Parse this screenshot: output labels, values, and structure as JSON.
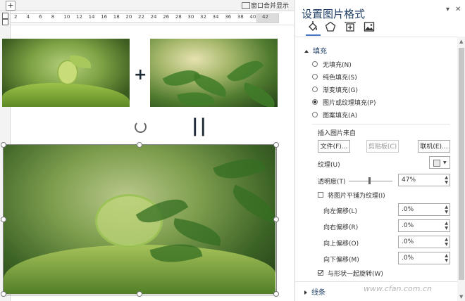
{
  "document": {
    "toolbar": {
      "plus_label": "+",
      "merge_label": "窗口合并显示"
    },
    "ruler_ticks": [
      "2",
      "4",
      "6",
      "8",
      "10",
      "12",
      "14",
      "16",
      "18",
      "20",
      "22",
      "24",
      "26",
      "28",
      "30",
      "32",
      "34",
      "36",
      "38",
      "40",
      "42"
    ],
    "operators": {
      "plus": "+",
      "equals": "||"
    }
  },
  "pane": {
    "title": "设置图片格式",
    "dropdown_icon": "chevron-down-icon",
    "close_icon": "close-icon",
    "tabs": [
      {
        "name": "fill-line-tab",
        "icon": "paint-bucket-icon"
      },
      {
        "name": "effects-tab",
        "icon": "pentagon-icon"
      },
      {
        "name": "layout-size-tab",
        "icon": "size-icon"
      },
      {
        "name": "picture-tab",
        "icon": "picture-icon"
      }
    ],
    "fill_section": {
      "label": "填充",
      "options": [
        {
          "label": "无填充(N)",
          "selected": false
        },
        {
          "label": "纯色填充(S)",
          "selected": false
        },
        {
          "label": "渐变填充(G)",
          "selected": false
        },
        {
          "label": "图片或纹理填充(P)",
          "selected": true
        },
        {
          "label": "图案填充(A)",
          "selected": false
        }
      ],
      "insert_from": "插入图片来自",
      "buttons": {
        "file": "文件(F)...",
        "clipboard": "剪贴板(C)",
        "online": "联机(E)..."
      },
      "texture_label": "纹理(U)",
      "transparency_label": "透明度(T)",
      "transparency_value": "47%",
      "transparency": 47,
      "tile_label": "将图片平铺为纹理(I)",
      "tile_checked": false,
      "offsets": [
        {
          "label": "向左偏移(L)",
          "value": ".0%"
        },
        {
          "label": "向右偏移(R)",
          "value": ".0%"
        },
        {
          "label": "向上偏移(O)",
          "value": ".0%"
        },
        {
          "label": "向下偏移(M)",
          "value": ".0%"
        }
      ],
      "rotate_label": "与形状一起旋转(W)",
      "rotate_checked": true
    },
    "line_section": {
      "label": "线条"
    }
  },
  "watermark": "www.cfan.com.cn"
}
